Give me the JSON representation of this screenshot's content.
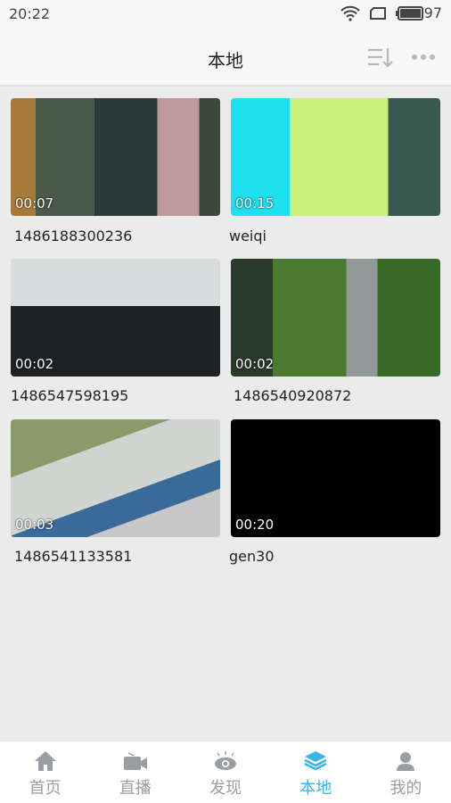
{
  "status": {
    "time": "20:22",
    "battery": "97"
  },
  "header": {
    "title": "本地",
    "icons": [
      "sort-icon",
      "more-icon"
    ]
  },
  "videos": [
    {
      "name": "1486188300236",
      "duration": "00:07"
    },
    {
      "name": "weiqi",
      "duration": "00:15"
    },
    {
      "name": "1486547598195",
      "duration": "00:02"
    },
    {
      "name": "1486540920872",
      "duration": "00:02"
    },
    {
      "name": "1486541133581",
      "duration": "00:03"
    },
    {
      "name": "gen30",
      "duration": "00:20"
    }
  ],
  "tabs": [
    {
      "label": "首页",
      "icon": "home-icon"
    },
    {
      "label": "直播",
      "icon": "camera-icon"
    },
    {
      "label": "发现",
      "icon": "eye-icon"
    },
    {
      "label": "本地",
      "icon": "layers-icon",
      "active": true
    },
    {
      "label": "我的",
      "icon": "user-icon"
    }
  ],
  "colors": {
    "accent": "#3ab4ea",
    "inactive": "#9a9ea3"
  }
}
